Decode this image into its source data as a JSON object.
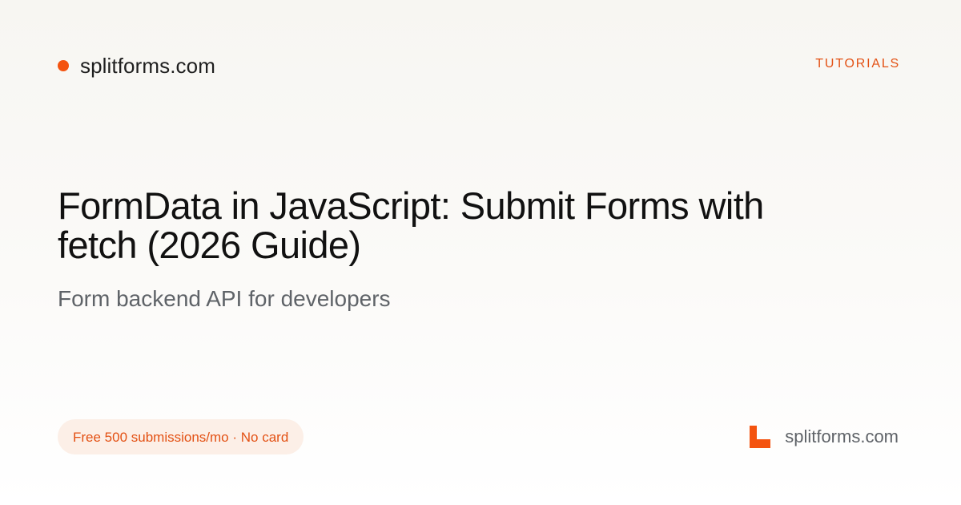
{
  "header": {
    "brand_text": "splitforms.com",
    "category": "TUTORIALS"
  },
  "main": {
    "title": "FormData in JavaScript: Submit Forms with fetch (2026 Guide)",
    "subtitle": "Form backend API for developers"
  },
  "footer": {
    "badge_text": "Free 500 submissions/mo · No card",
    "brand_text": "splitforms.com",
    "logo_icon": "l-shape-logo-icon"
  },
  "colors": {
    "accent": "#f4530f",
    "badge_background": "#fcefe7",
    "muted_text": "#5f6368",
    "title_text": "#111111"
  }
}
